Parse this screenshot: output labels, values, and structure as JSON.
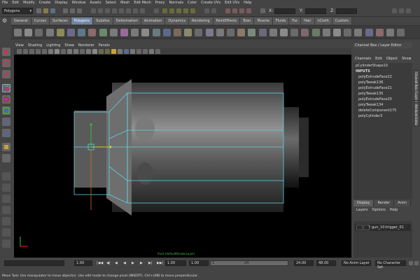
{
  "menubar": [
    "File",
    "Edit",
    "Modify",
    "Create",
    "Display",
    "Window",
    "Assets",
    "Select",
    "Mesh",
    "Edit Mesh",
    "Proxy",
    "Normals",
    "Color",
    "Create UVs",
    "Edit UVs",
    "Help"
  ],
  "status": {
    "mode": "Polygons",
    "x_label": "X:",
    "y_label": "Y:",
    "z_label": "Z:"
  },
  "shelf": {
    "tabs": [
      "General",
      "Curves",
      "Surfaces",
      "Polygons",
      "Subdivs",
      "Deformation",
      "Animation",
      "Dynamics",
      "Rendering",
      "PaintEffects",
      "Toon",
      "Muscle",
      "Fluids",
      "Fur",
      "Hair",
      "nCloth",
      "Custom"
    ],
    "active": "Polygons"
  },
  "viewport": {
    "menu": [
      "View",
      "Shading",
      "Lighting",
      "Show",
      "Renderer",
      "Panels"
    ],
    "camera_label": "front (defaultRenderLayer)"
  },
  "channel_box": {
    "header": "Channel Box / Layer Editor",
    "menu": [
      "Channels",
      "Edit",
      "Object",
      "Show"
    ],
    "shape": "pCylinderShape10",
    "inputs_label": "INPUTS",
    "inputs": [
      "polyExtrudeFace22",
      "polyTweak136",
      "polyExtrudeFace21",
      "polyTweak135",
      "polyExtrudeFace20",
      "polyTweak134",
      "deleteComponent175",
      "polyCylinder3"
    ],
    "side_tabs": [
      "Channel Box / Layer Editor",
      "Attribute Editor"
    ]
  },
  "layer_editor": {
    "tabs": [
      "Display",
      "Render",
      "Anim"
    ],
    "active": "Display",
    "menu": [
      "Layers",
      "Options",
      "Help"
    ],
    "layer_name": "gun_10:trigger_01"
  },
  "timeslider": {
    "start": "1.00",
    "current": "1.00",
    "range_start": "1.00",
    "frame_marker": "1",
    "range_tick": "24",
    "range_end": "24.00",
    "end": "48.00",
    "anim_layer": "No Anim Layer",
    "character_set": "No Character Set"
  },
  "helpline": "Move Tool: Use manipulator to move object(s). Use edit mode to change pivot (INSERT). Ctrl+LMB to move perpendicular.",
  "colors": {
    "wireframe": "#5fd3e3",
    "background": "#444444",
    "active_tab": "#6f86a3",
    "manipulator_yellow": "#e8e000",
    "manipulator_green": "#33cc33"
  }
}
